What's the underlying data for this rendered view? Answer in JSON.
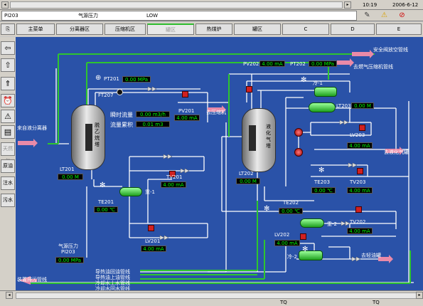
{
  "topbar": {
    "time": "10:19",
    "date": "2006-6-12"
  },
  "alarmbar": {
    "tag": "PI203",
    "description": "气源压力",
    "state": "LOW"
  },
  "toolbar_icons": [
    "notebook-icon",
    "warning-icon",
    "no-entry-icon"
  ],
  "nav": {
    "tabs": [
      "主菜单",
      "分离器区",
      "压缩机区",
      "罐区",
      "热煤炉",
      "罐区",
      "C",
      "D",
      "E"
    ],
    "active_index": 3
  },
  "sidebar": {
    "items": [
      "返回",
      "上",
      "上",
      "报警",
      "警告",
      "趋势",
      "天然气",
      "原油",
      "注水",
      "污水"
    ]
  },
  "process": {
    "pipes": {
      "safety_vent": "安全阀放空管线",
      "to_compressor_top": "去燃气压缩机管线",
      "to_compressor": "去压缩机",
      "from_separator": "来自液分离器",
      "to_liquefied_tank": "去液化气罐",
      "to_light_oil_tank": "去轻油罐",
      "heat_oil_return": "导热油回油管线",
      "heat_oil_supply": "导热油上油管线",
      "cooling_water_supply": "冷却水上水管线",
      "cooling_water_return": "冷却水回水管线",
      "sewage": "装置排污管线"
    },
    "vessels": {
      "left": "脱乙烷塔",
      "right": "液化气塔"
    },
    "exchangers": {
      "e1": "冷-1",
      "e2": "冷-2",
      "r1": "重-1",
      "r2": "重-2"
    },
    "flow": {
      "instant_label": "瞬时流量",
      "accum_label": "流量累积",
      "instant_value": "0.00 m3/h",
      "accum_value": "0.01 m3"
    },
    "instruments": {
      "pt201": {
        "tag": "PT201",
        "value": "0.00 MPa"
      },
      "ft207": {
        "tag": "FT207"
      },
      "pv201": {
        "tag": "PV201",
        "value": "4.00 mA"
      },
      "lt201": {
        "tag": "LT201",
        "value": "0.00 M"
      },
      "tv201": {
        "tag": "TV201",
        "value": "4.00 mA"
      },
      "te201": {
        "tag": "TE201",
        "value": "0.00 ℃"
      },
      "lv201": {
        "tag": "LV201",
        "value": "4.00 mA"
      },
      "pi203": {
        "label": "气源压力",
        "tag": "PI203",
        "value": "0.00 MPa"
      },
      "pv202": {
        "tag": "PV202",
        "value": "4.00 mA"
      },
      "pt202": {
        "tag": "PT202",
        "value": "0.00 MPa"
      },
      "lt203": {
        "tag": "LT203",
        "value": "0.00 M"
      },
      "lv203": {
        "tag": "LV203",
        "value": "4.00 mA"
      },
      "tv203": {
        "tag": "TV203",
        "value": "4.00 mA"
      },
      "te203": {
        "tag": "TE203",
        "value": "0.00 ℃"
      },
      "lt202": {
        "tag": "LT202",
        "value": "0.00 M"
      },
      "te202": {
        "tag": "TE202",
        "value": "0.00 ℃"
      },
      "tv202": {
        "tag": "TV202",
        "value": "4.00 mA"
      },
      "lv202": {
        "tag": "LV202",
        "value": "4.00 mA"
      }
    }
  },
  "bottombar": {
    "left_status": "TQ",
    "right_status": "TQ"
  },
  "colors": {
    "background": "#2a52a8",
    "pipe": "#ffffff",
    "green_pipe": "#2ec52e",
    "value_text": "#00ff00"
  }
}
